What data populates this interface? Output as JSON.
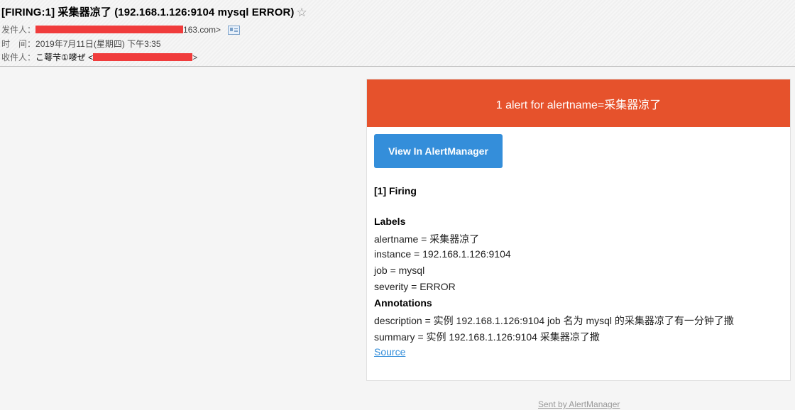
{
  "email": {
    "subject": "[FIRING:1] 采集器凉了 (192.168.1.126:9104 mysql ERROR)",
    "star_icon": "☆",
    "from_label": "发件人：",
    "from_suffix": "163.com>",
    "time_label": "时　间：",
    "time_value": "2019年7月11日(星期四) 下午3:35",
    "to_label": "收件人：",
    "to_name": "こ萼芐①嘜ぜ <",
    "to_suffix": ">"
  },
  "alert": {
    "banner_title": "1 alert for alertname=采集器凉了",
    "view_button_label": "View In AlertManager",
    "firing_heading": "[1] Firing",
    "labels_heading": "Labels",
    "labels": [
      "alertname = 采集器凉了",
      "instance = 192.168.1.126:9104",
      "job = mysql",
      "severity = ERROR"
    ],
    "annotations_heading": "Annotations",
    "annotations": [
      "description = 实例 192.168.1.126:9104 job 名为 mysql 的采集器凉了有一分钟了撒",
      "summary = 实例 192.168.1.126:9104 采集器凉了撒"
    ],
    "source_link": "Source"
  },
  "footer": {
    "sent_by": "Sent by AlertManager"
  },
  "colors": {
    "banner": "#e6522c",
    "button": "#348eda",
    "redaction": "#f03c3c"
  }
}
